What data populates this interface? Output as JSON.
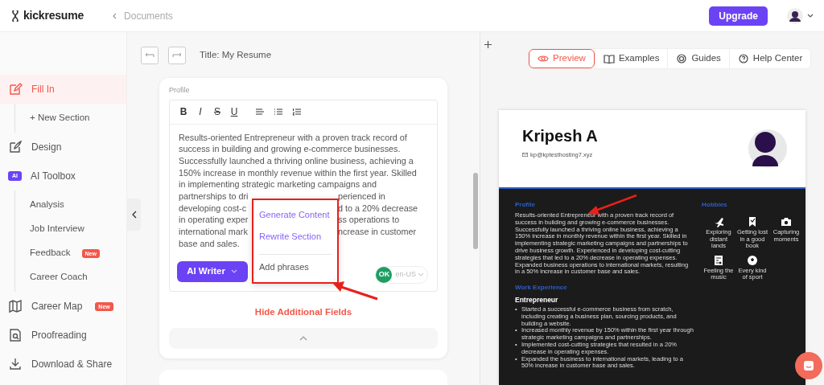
{
  "header": {
    "logo": "kickresume",
    "breadcrumb": "Documents",
    "upgrade_button": "Upgrade"
  },
  "sidebar": {
    "items": [
      {
        "label": "Fill In",
        "kind": "main",
        "selected": true,
        "children": [
          {
            "label": "+ New Section",
            "kind": "sub",
            "selected": false
          }
        ]
      },
      {
        "label": "Design",
        "kind": "main",
        "selected": false
      },
      {
        "label": "AI Toolbox",
        "kind": "main",
        "selected": false,
        "tag": "AI",
        "children": [
          {
            "label": "Analysis",
            "kind": "sub",
            "selected": false
          },
          {
            "label": "Job Interview",
            "kind": "sub",
            "selected": false
          },
          {
            "label": "Feedback",
            "kind": "sub",
            "selected": false,
            "badge": "New"
          },
          {
            "label": "Career Coach",
            "kind": "sub",
            "selected": false
          }
        ]
      },
      {
        "label": "Career Map",
        "kind": "main",
        "selected": false,
        "badge": "New"
      },
      {
        "label": "Proofreading",
        "kind": "main",
        "selected": false
      },
      {
        "label": "Download & Share",
        "kind": "main",
        "selected": false
      }
    ]
  },
  "editor": {
    "title": "Title: My Resume",
    "section_label": "Profile",
    "format_buttons": [
      "B",
      "I",
      "S",
      "U"
    ],
    "text_lines": [
      [
        "Results-oriented Entrepreneur with a proven track record of"
      ],
      [
        "success in building and growing e-commerce businesses."
      ],
      [
        "Successfully launched a thriving online business, achieving a"
      ],
      [
        "150% increase in monthly revenue within the first year. Skilled"
      ],
      [
        "in implementing strategic marketing campaigns and"
      ],
      [
        "partnerships to dri",
        "perienced in"
      ],
      [
        "developing cost-c",
        "d to a 20% decrease"
      ],
      [
        "in operating exper",
        "ss operations to"
      ],
      [
        "international mark",
        "ncrease in customer"
      ],
      [
        "base and sales."
      ]
    ],
    "ai_writer_button": "AI Writer",
    "spell_status": "OK",
    "language": "en-US",
    "ai_menu": [
      {
        "label": "Generate Content",
        "kind": "ai"
      },
      {
        "label": "Rewrite Section",
        "kind": "ai"
      },
      {
        "label": "Add phrases",
        "kind": "plain"
      }
    ],
    "hide_fields_link": "Hide Additional Fields"
  },
  "preview_tabs": [
    {
      "label": "Preview",
      "selected": true
    },
    {
      "label": "Examples",
      "selected": false
    },
    {
      "label": "Guides",
      "selected": false
    },
    {
      "label": "Help Center",
      "selected": false
    }
  ],
  "resume": {
    "name": "Kripesh A",
    "email": "kp@kptesthosting7.xyz",
    "profile_heading": "Profile",
    "profile_text": "Results-oriented Entrepreneur with a proven track record of success in building and growing e-commerce businesses. Successfully launched a thriving online business, achieving a 150% increase in monthly revenue within the first year. Skilled in implementing strategic marketing campaigns and partnerships to drive business growth. Experienced in developing cost-cutting strategies that led to a 20% decrease in operating expenses. Expanded business operations to international markets, resulting in a 50% increase in customer base and sales.",
    "hobbies_heading": "Hobbies",
    "hobbies": [
      "Exploring distant lands",
      "Getting lost in a good book",
      "Capturing moments",
      "Feeling the music",
      "Every kind of sport"
    ],
    "work_heading": "Work Experience",
    "job_title": "Entrepreneur",
    "job_bullets": [
      {
        "mark": "•",
        "text": "Started a successful e-commerce business from scratch, including creating a business plan, sourcing products, and building a website."
      },
      {
        "mark": "•",
        "text": "Increased monthly revenue by 150% within the first year through strategic marketing campaigns and partnerships."
      },
      {
        "mark": "•",
        "text": "Implemented cost-cutting strategies that resulted in a 20% decrease in operating expenses."
      },
      {
        "mark": "•",
        "text": "Expanded the business to international markets, leading to a 50% increase in customer base and sales."
      }
    ]
  }
}
